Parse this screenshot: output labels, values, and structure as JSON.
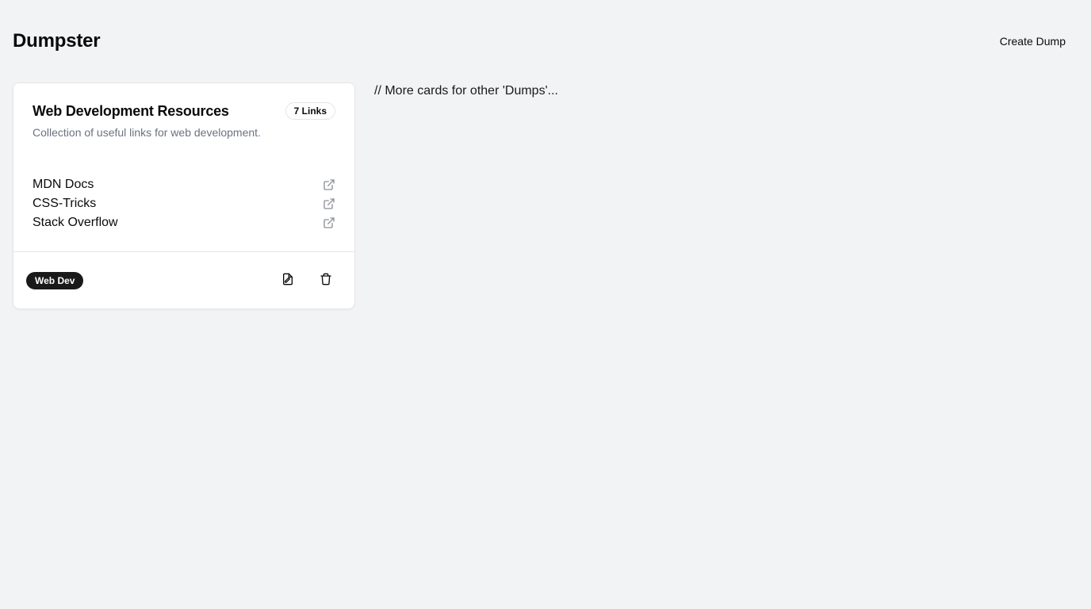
{
  "header": {
    "title": "Dumpster",
    "create_label": "Create Dump"
  },
  "card": {
    "title": "Web Development Resources",
    "count_label": "7 Links",
    "description": "Collection of useful links for web development.",
    "links": [
      {
        "label": "MDN Docs",
        "icon": "external-link-icon"
      },
      {
        "label": "CSS-Tricks",
        "icon": "external-link-icon"
      },
      {
        "label": "Stack Overflow",
        "icon": "external-link-icon"
      }
    ],
    "tag": "Web Dev",
    "actions": [
      {
        "icon": "edit-file-icon"
      },
      {
        "icon": "trash-icon"
      }
    ]
  },
  "placeholder_note": "// More cards for other 'Dumps'..."
}
